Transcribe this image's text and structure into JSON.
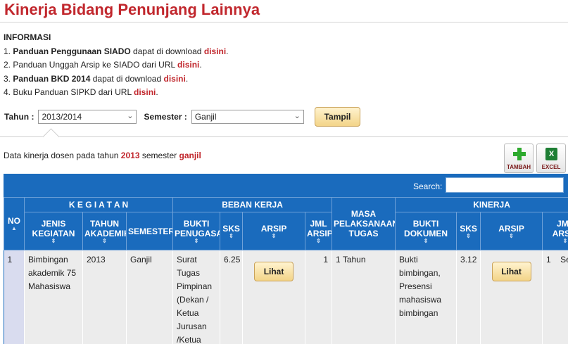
{
  "page": {
    "title": "Kinerja Bidang Penunjang Lainnya"
  },
  "info": {
    "heading": "INFORMASI",
    "items": [
      {
        "num": "1.",
        "bold": "Panduan Penggunaan SIADO",
        "text": " dapat di download ",
        "link": "disini",
        "end": "."
      },
      {
        "num": "2.",
        "bold": "",
        "text": "Panduan Unggah Arsip ke SIADO dari URL ",
        "link": "disini",
        "end": "."
      },
      {
        "num": "3.",
        "bold": "Panduan BKD 2014",
        "text": " dapat di download ",
        "link": "disini",
        "end": "."
      },
      {
        "num": "4.",
        "bold": "",
        "text": "Buku Panduan SIPKD dari URL ",
        "link": "disini",
        "end": "."
      }
    ]
  },
  "filter": {
    "tahun_label": "Tahun :",
    "tahun_value": "2013/2014",
    "semester_label": "Semester :",
    "semester_value": "Ganjil",
    "button": "Tampil"
  },
  "description": {
    "prefix": "Data kinerja dosen pada tahun ",
    "year": "2013",
    "mid": " semester ",
    "semester": "ganjil"
  },
  "toolbar": {
    "add_label": "TAMBAH",
    "excel_label": "EXCEL"
  },
  "grid": {
    "search_label": "Search:",
    "group_headers": {
      "no": "NO",
      "kegiatan": "K E G I A T A N",
      "beban": "BEBAN KERJA",
      "masa": "MASA PELAKSANAAN TUGAS",
      "kinerja": "KINERJA"
    },
    "columns": {
      "jenis": "JENIS KEGIATAN",
      "tahun": "TAHUN AKADEMIK",
      "semester": "SEMESTER",
      "bukti_penugasan": "BUKTI PENUGASAN",
      "sks": "SKS",
      "arsip": "ARSIP",
      "jml_arsip": "JML ARSIP",
      "bukti_dokumen": "BUKTI DOKUMEN",
      "sks2": "SKS",
      "arsip2": "ARSIP",
      "jml_arsip2": "JML ARSIP"
    },
    "rows": [
      {
        "no": "1",
        "jenis": "Bimbingan akademik 75 Mahasiswa",
        "tahun": "2013",
        "semester": "Ganjil",
        "bukti_penugasan": "Surat Tugas Pimpinan (Dekan / Ketua Jurusan /Ketua",
        "sks": "6.25",
        "arsip_button": "Lihat",
        "jml_arsip": "1",
        "masa": "1 Tahun",
        "bukti_dokumen": "Bukti bimbingan, Presensi mahasiswa bimbingan",
        "sks2": "3.12",
        "arsip2_button": "Lihat",
        "jml_arsip2": "1",
        "status": "Selesai"
      }
    ]
  },
  "colors": {
    "accent": "#c1272d",
    "header_blue": "#1a6bbd",
    "button_gold": "#f3d488"
  }
}
